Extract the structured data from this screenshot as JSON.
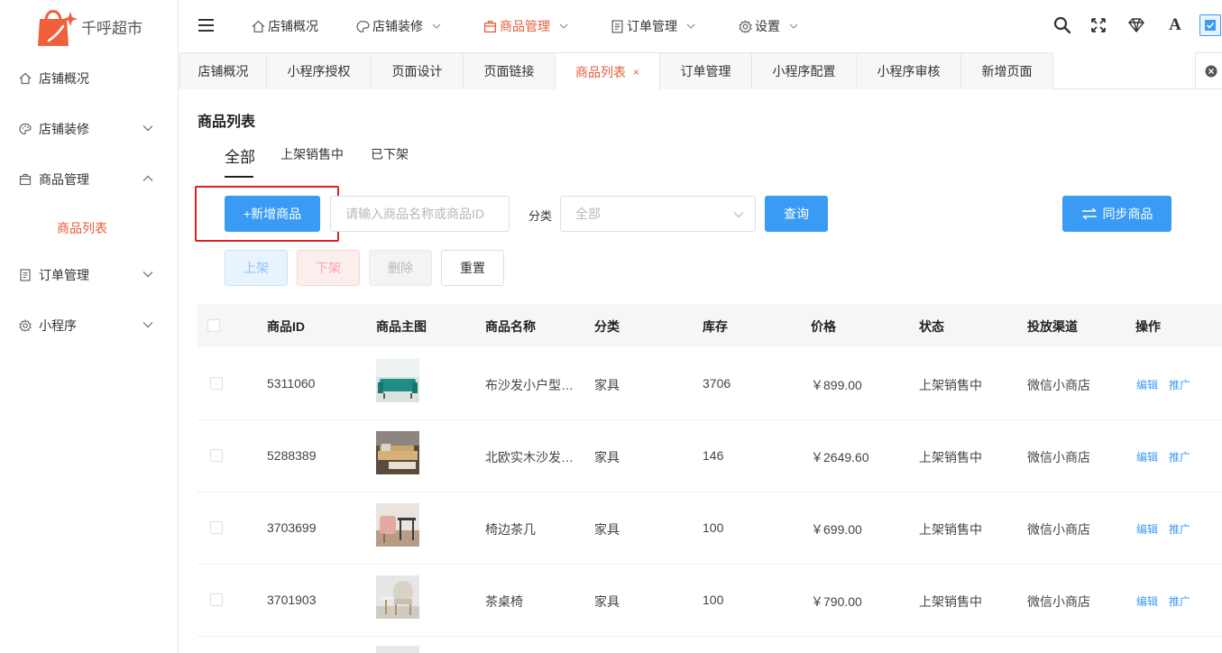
{
  "brand": {
    "name": "千呼超市",
    "color": "#f0603a"
  },
  "sidebar": {
    "items": [
      {
        "label": "店铺概况",
        "icon": "home-icon"
      },
      {
        "label": "店铺装修",
        "icon": "palette-icon"
      },
      {
        "label": "商品管理",
        "icon": "bag-icon"
      },
      {
        "label": "订单管理",
        "icon": "document-icon"
      },
      {
        "label": "小程序",
        "icon": "gear-icon"
      }
    ],
    "sub_item": "商品列表"
  },
  "topnav": {
    "items": [
      {
        "label": "店铺概况",
        "icon": "home-icon"
      },
      {
        "label": "店铺装修",
        "icon": "palette-icon"
      },
      {
        "label": "商品管理",
        "icon": "bag-icon"
      },
      {
        "label": "订单管理",
        "icon": "document-icon"
      },
      {
        "label": "设置",
        "icon": "gear-icon"
      }
    ],
    "font_icon_glyph": "A"
  },
  "tabs": [
    "店铺概况",
    "小程序授权",
    "页面设计",
    "页面链接",
    "商品列表",
    "订单管理",
    "小程序配置",
    "小程序审核",
    "新增页面"
  ],
  "tab_close": "×",
  "page": {
    "title": "商品列表",
    "subtabs": [
      "全部",
      "上架销售中",
      "已下架"
    ]
  },
  "toolbar": {
    "add_label": "+新增商品",
    "search_placeholder": "请输入商品名称或商品ID",
    "category_label": "分类",
    "category_value": "全部",
    "query_label": "查询",
    "sync_label": "同步商品",
    "up_label": "上架",
    "down_label": "下架",
    "delete_label": "删除",
    "reset_label": "重置"
  },
  "table": {
    "headers": [
      "商品ID",
      "商品主图",
      "商品名称",
      "分类",
      "库存",
      "价格",
      "状态",
      "投放渠道",
      "操作"
    ],
    "rows": [
      {
        "id": "5311060",
        "name": "布沙发小户型…",
        "category": "家具",
        "stock": "3706",
        "price": "￥899.00",
        "status": "上架销售中",
        "channel": "微信小商店",
        "edit": "编辑",
        "promote": "推广"
      },
      {
        "id": "5288389",
        "name": "北欧实木沙发…",
        "category": "家具",
        "stock": "146",
        "price": "￥2649.60",
        "status": "上架销售中",
        "channel": "微信小商店",
        "edit": "编辑",
        "promote": "推广"
      },
      {
        "id": "3703699",
        "name": "椅边茶几",
        "category": "家具",
        "stock": "100",
        "price": "￥699.00",
        "status": "上架销售中",
        "channel": "微信小商店",
        "edit": "编辑",
        "promote": "推广"
      },
      {
        "id": "3701903",
        "name": "茶桌椅",
        "category": "家具",
        "stock": "100",
        "price": "￥790.00",
        "status": "上架销售中",
        "channel": "微信小商店",
        "edit": "编辑",
        "promote": "推广"
      }
    ]
  },
  "colors": {
    "accent": "#e55c3b",
    "primary": "#3a9bf5",
    "highlight": "#e02020"
  }
}
